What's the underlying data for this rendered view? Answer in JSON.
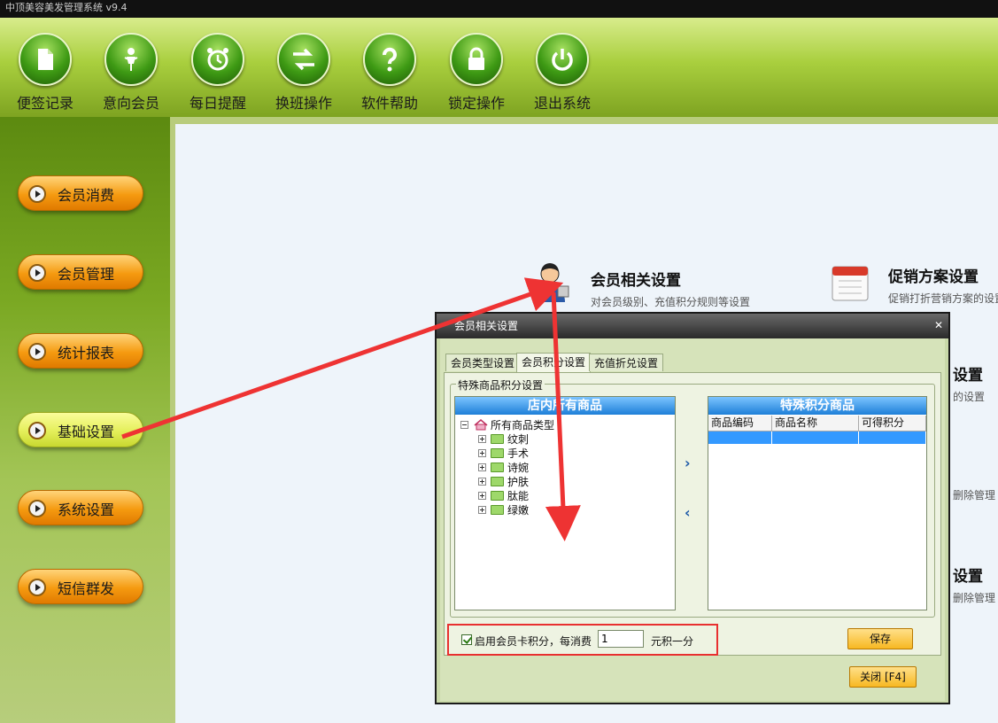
{
  "app": {
    "title": "中顶美容美发管理系统 v9.4"
  },
  "toolbar": [
    {
      "label": "便签记录",
      "icon": "note-icon"
    },
    {
      "label": "意向会员",
      "icon": "person-icon"
    },
    {
      "label": "每日提醒",
      "icon": "alarm-clock-icon"
    },
    {
      "label": "换班操作",
      "icon": "swap-arrows-icon"
    },
    {
      "label": "软件帮助",
      "icon": "help-icon"
    },
    {
      "label": "锁定操作",
      "icon": "lock-icon"
    },
    {
      "label": "退出系统",
      "icon": "power-icon"
    }
  ],
  "sidebar": [
    {
      "label": "会员消费",
      "active": false
    },
    {
      "label": "会员管理",
      "active": false
    },
    {
      "label": "统计报表",
      "active": false
    },
    {
      "label": "基础设置",
      "active": true
    },
    {
      "label": "系统设置",
      "active": false
    },
    {
      "label": "短信群发",
      "active": false
    }
  ],
  "settings": {
    "member": {
      "title": "会员相关设置",
      "desc": "对会员级别、充值积分规则等设置"
    },
    "promo": {
      "title": "促销方案设置",
      "desc": "促销打折营销方案的设置"
    },
    "partial1": {
      "title": "设置",
      "desc": "的设置"
    },
    "partial2": {
      "desc": "删除管理"
    },
    "partial3": {
      "title": "设置",
      "desc": "删除管理"
    }
  },
  "dialog": {
    "title": "会员相关设置",
    "close_glyph": "✕",
    "tabs": [
      {
        "label": "会员类型设置",
        "active": false
      },
      {
        "label": "会员积分设置",
        "active": true
      },
      {
        "label": "充值折兑设置",
        "active": false
      }
    ],
    "group_label": "特殊商品积分设置",
    "left_list": {
      "header": "店内所有商品",
      "root": "所有商品类型",
      "children": [
        "纹刺",
        "手术",
        "诗婉",
        "护肤",
        "肽能",
        "绿嫩"
      ]
    },
    "right_list": {
      "header": "特殊积分商品",
      "columns": [
        "商品编码",
        "商品名称",
        "可得积分"
      ]
    },
    "move_right": "›",
    "move_left": "‹",
    "enable_label": "启用会员卡积分，每消费",
    "enable_checked": true,
    "amount": "1",
    "unit_label": "元积一分",
    "save_label": "保存",
    "close_label": "关闭 [F4]"
  },
  "colors": {
    "highlight": "#e83030",
    "list_header": "#1e7fd8",
    "accent_orange": "#f59a10"
  }
}
